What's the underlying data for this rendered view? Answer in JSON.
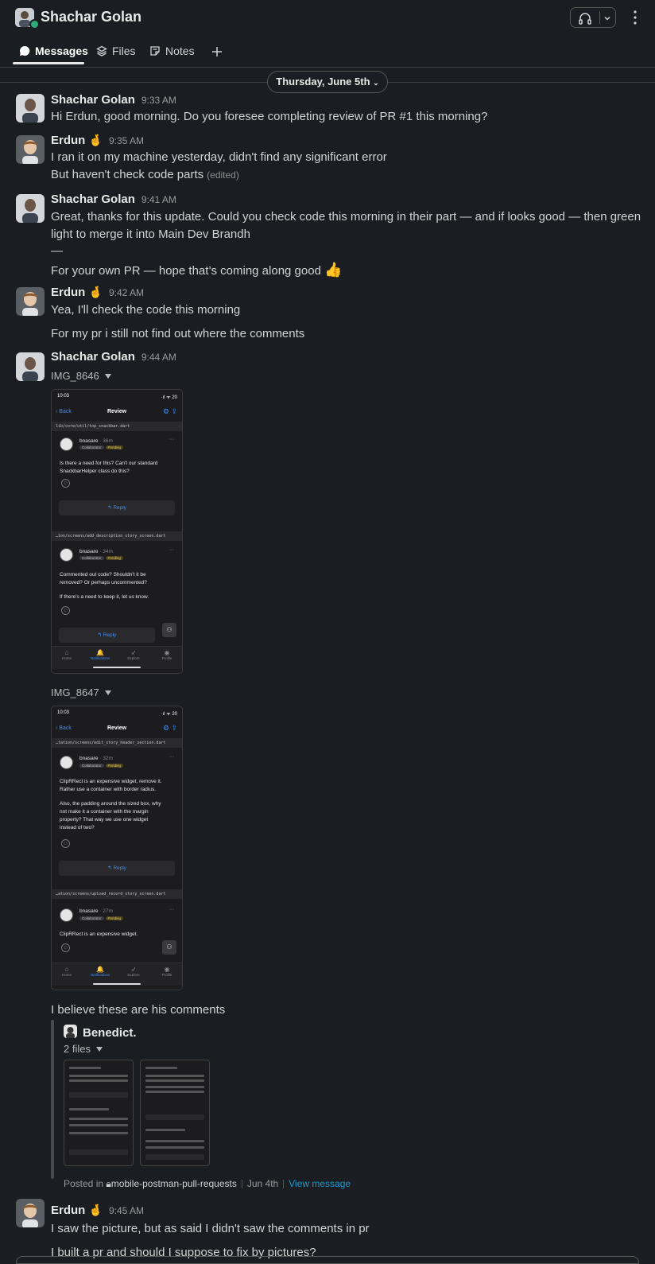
{
  "header": {
    "title": "Shachar Golan",
    "status_color": "#2bac76",
    "huddle_icon": "headphones-icon",
    "menu_icon": "more-vertical-icon"
  },
  "tabs": [
    {
      "label": "Messages",
      "icon": "message-bubble-icon",
      "active": true
    },
    {
      "label": "Files",
      "icon": "layers-icon",
      "active": false
    },
    {
      "label": "Notes",
      "icon": "notes-icon",
      "active": false
    }
  ],
  "add_tab_icon": "plus-icon",
  "date_divider": "Thursday, June 5th",
  "messages": [
    {
      "sender": "Shachar Golan",
      "time": "9:33 AM",
      "lines": [
        "Hi Erdun, good morning. Do you foresee completing review of PR #1 this morning?"
      ]
    },
    {
      "sender": "Erdun",
      "emoji": "🤞",
      "time": "9:35 AM",
      "lines": [
        "I ran it on my machine yesterday, didn't find any significant error",
        "But haven't check code parts"
      ],
      "edited": "(edited)"
    },
    {
      "sender": "Shachar Golan",
      "time": "9:41 AM",
      "lines": [
        "Great, thanks for this update. Could you check code this morning in their part — and if looks good — then green",
        "light to merge it into Main Dev Brandh",
        "—",
        "For your own PR — hope that’s coming along good"
      ],
      "emoji_end": "👍"
    },
    {
      "sender": "Erdun",
      "emoji": "🤞",
      "time": "9:42 AM",
      "lines": [
        "Yea, I'll check the code this morning",
        "For my pr i still not find out where the comments"
      ]
    },
    {
      "sender": "Shachar Golan",
      "time": "9:44 AM",
      "files": [
        "IMG_8646",
        "IMG_8647"
      ],
      "after_text": "I believe these are his comments"
    },
    {
      "sender": "Erdun",
      "emoji": "🤞",
      "time": "9:45 AM",
      "lines": [
        "I saw the picture, but as said I didn't saw the comments in pr",
        "I built a pr and should I suppose to fix by pictures?"
      ]
    }
  ],
  "screens": {
    "status_time": "10:03",
    "status_right": "·ıl ᯤ 20",
    "back": "Back",
    "title": "Review",
    "reply": "↰ Reply",
    "user": "bnasare",
    "tag_collab": "Collaborator",
    "tag_pending": "Pending",
    "tabbar": [
      "Home",
      "Notifications",
      "Explore",
      "Profile"
    ],
    "img1": {
      "path1": "lib/core/util/top_snackbar.dart",
      "age1": "· 36m",
      "text1": [
        "Is there a need for this? Can't our standard",
        "SnackbarHelper class do this?"
      ],
      "path2": "…ion/screens/add_description_story_screen.dart",
      "age2": "· 34m",
      "text2": [
        "Commented out code? Shouldn't it be",
        "removed? Or perhaps uncommented?"
      ],
      "text3": [
        "If there's a need to keep it, let us know."
      ]
    },
    "img2": {
      "path1": "…tation/screens/edit_story_header_section.dart",
      "age1": "· 32m",
      "text1": [
        "ClipRRect is an expensive widget, remove it.",
        "Rather use a container with border radius."
      ],
      "text2": [
        "Also, the padding around the sized box, why",
        "not make it a container with the margin",
        "property? That way we use one widget",
        "instead of two?"
      ],
      "path2": "…ation/screens/upload_record_story_screen.dart",
      "age2": "· 27m",
      "text3": [
        "ClipRRect is an expensive widget."
      ]
    }
  },
  "shared": {
    "author": "Benedict.",
    "files_label": "2 files",
    "posted_in": "Posted in",
    "channel": "mobile-postman-pull-requests",
    "date": "Jun 4th",
    "view": "View message"
  }
}
